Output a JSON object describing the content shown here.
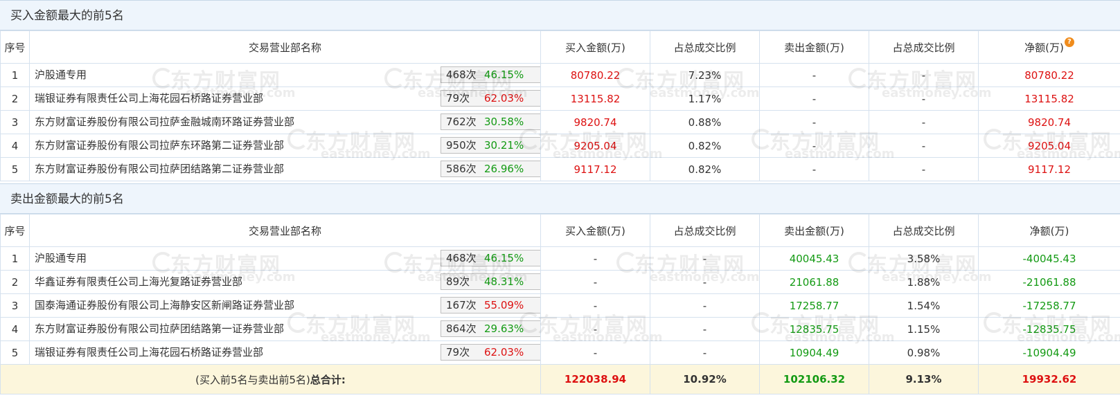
{
  "buy_section": {
    "title": "买入金额最大的前5名",
    "headers": [
      "序号",
      "交易营业部名称",
      "买入金额(万)",
      "占总成交比例",
      "卖出金额(万)",
      "占总成交比例",
      "净额(万)"
    ],
    "rows": [
      {
        "idx": "1",
        "name": "沪股通专用",
        "times": "468次",
        "rate": "46.15%",
        "rate_color": "green",
        "icon": "help-icon",
        "buy": "80780.22",
        "buy_pct": "7.23%",
        "sell": "-",
        "sell_pct": "-",
        "net": "80780.22"
      },
      {
        "idx": "2",
        "name": "瑞银证券有限责任公司上海花园石桥路证券营业部",
        "times": "79次",
        "rate": "62.03%",
        "rate_color": "red",
        "icon": "play-icon",
        "buy": "13115.82",
        "buy_pct": "1.17%",
        "sell": "-",
        "sell_pct": "-",
        "net": "13115.82"
      },
      {
        "idx": "3",
        "name": "东方财富证券股份有限公司拉萨金融城南环路证券营业部",
        "times": "762次",
        "rate": "30.58%",
        "rate_color": "green",
        "icon": "play-icon",
        "buy": "9820.74",
        "buy_pct": "0.88%",
        "sell": "-",
        "sell_pct": "-",
        "net": "9820.74"
      },
      {
        "idx": "4",
        "name": "东方财富证券股份有限公司拉萨东环路第二证券营业部",
        "times": "950次",
        "rate": "30.21%",
        "rate_color": "green",
        "icon": "play-icon",
        "buy": "9205.04",
        "buy_pct": "0.82%",
        "sell": "-",
        "sell_pct": "-",
        "net": "9205.04"
      },
      {
        "idx": "5",
        "name": "东方财富证券股份有限公司拉萨团结路第二证券营业部",
        "times": "586次",
        "rate": "26.96%",
        "rate_color": "green",
        "icon": "play-icon",
        "buy": "9117.12",
        "buy_pct": "0.82%",
        "sell": "-",
        "sell_pct": "-",
        "net": "9117.12"
      }
    ]
  },
  "sell_section": {
    "title": "卖出金额最大的前5名",
    "headers": [
      "序号",
      "交易营业部名称",
      "买入金额(万)",
      "占总成交比例",
      "卖出金额(万)",
      "占总成交比例",
      "净额(万)"
    ],
    "rows": [
      {
        "idx": "1",
        "name": "沪股通专用",
        "times": "468次",
        "rate": "46.15%",
        "rate_color": "green",
        "icon": "help-icon",
        "buy": "-",
        "buy_pct": "-",
        "sell": "40045.43",
        "sell_pct": "3.58%",
        "net": "-40045.43"
      },
      {
        "idx": "2",
        "name": "华鑫证券有限责任公司上海光复路证券营业部",
        "times": "89次",
        "rate": "48.31%",
        "rate_color": "green",
        "icon": "play-icon",
        "buy": "-",
        "buy_pct": "-",
        "sell": "21061.88",
        "sell_pct": "1.88%",
        "net": "-21061.88"
      },
      {
        "idx": "3",
        "name": "国泰海通证券股份有限公司上海静安区新闸路证券营业部",
        "times": "167次",
        "rate": "55.09%",
        "rate_color": "red",
        "icon": "play-icon",
        "buy": "-",
        "buy_pct": "-",
        "sell": "17258.77",
        "sell_pct": "1.54%",
        "net": "-17258.77"
      },
      {
        "idx": "4",
        "name": "东方财富证券股份有限公司拉萨团结路第一证券营业部",
        "times": "864次",
        "rate": "29.63%",
        "rate_color": "green",
        "icon": "play-icon",
        "buy": "-",
        "buy_pct": "-",
        "sell": "12835.75",
        "sell_pct": "1.15%",
        "net": "-12835.75"
      },
      {
        "idx": "5",
        "name": "瑞银证券有限责任公司上海花园石桥路证券营业部",
        "times": "79次",
        "rate": "62.03%",
        "rate_color": "red",
        "icon": "play-icon",
        "buy": "-",
        "buy_pct": "-",
        "sell": "10904.49",
        "sell_pct": "0.98%",
        "net": "-10904.49"
      }
    ],
    "total": {
      "label_prefix": "(买入前5名与卖出前5名)",
      "label_bold": "总合计:",
      "buy": "122038.94",
      "buy_pct": "10.92%",
      "sell": "102106.32",
      "sell_pct": "9.13%",
      "net": "19932.62"
    }
  },
  "help_icon_glyph": "?",
  "watermark": {
    "cn": "东方财富网",
    "en": "eastmoney.com"
  },
  "colors": {
    "buy": "#dd1111",
    "sell": "#139a13",
    "header_bg": "#eef5fc",
    "total_bg": "#fcf6dc",
    "help": "#f08c1c",
    "play": "#1f4d8c"
  }
}
